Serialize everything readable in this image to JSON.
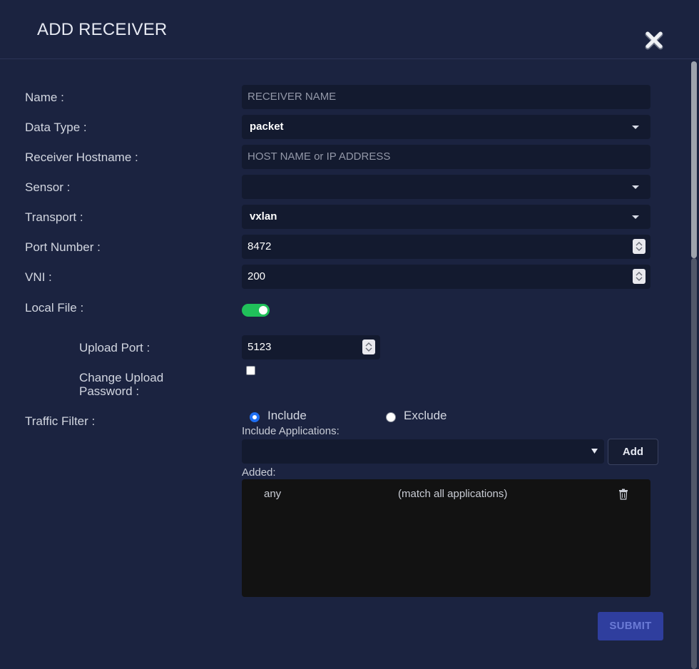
{
  "dialog": {
    "title": "ADD RECEIVER"
  },
  "form": {
    "name_label": "Name :",
    "name_placeholder": "RECEIVER NAME",
    "data_type_label": "Data Type :",
    "data_type_value": "packet",
    "hostname_label": "Receiver Hostname :",
    "hostname_placeholder": "HOST NAME or IP ADDRESS",
    "sensor_label": "Sensor :",
    "sensor_value": "",
    "transport_label": "Transport :",
    "transport_value": "vxlan",
    "port_label": "Port Number :",
    "port_value": "8472",
    "vni_label": "VNI :",
    "vni_value": "200",
    "local_file_label": "Local File :",
    "local_file_enabled": true,
    "upload_port_label": "Upload Port :",
    "upload_port_value": "5123",
    "change_pw_label_line1": "Change Upload",
    "change_pw_label_line2": "Password :",
    "change_pw_checked": false,
    "traffic_filter_label": "Traffic Filter :",
    "include_label": "Include",
    "exclude_label": "Exclude",
    "traffic_filter_selected": "Include",
    "include_apps_label": "Include Applications:",
    "include_apps_value": "",
    "add_button_label": "Add",
    "added_label": "Added:",
    "added_items": [
      {
        "name": "any",
        "description": "(match all applications)"
      }
    ],
    "submit_label": "SUBMIT"
  },
  "colors": {
    "background": "#1b2340",
    "field_bg": "#131a2f",
    "toggle_on": "#20c05a",
    "submit_bg": "#2f3e9e",
    "radio_selected": "#1f6ff2"
  },
  "icons": {
    "close": "close-x-icon",
    "select_caret": "caret-down-icon",
    "spinner": "number-spinner-icon",
    "delete": "trash-icon"
  }
}
